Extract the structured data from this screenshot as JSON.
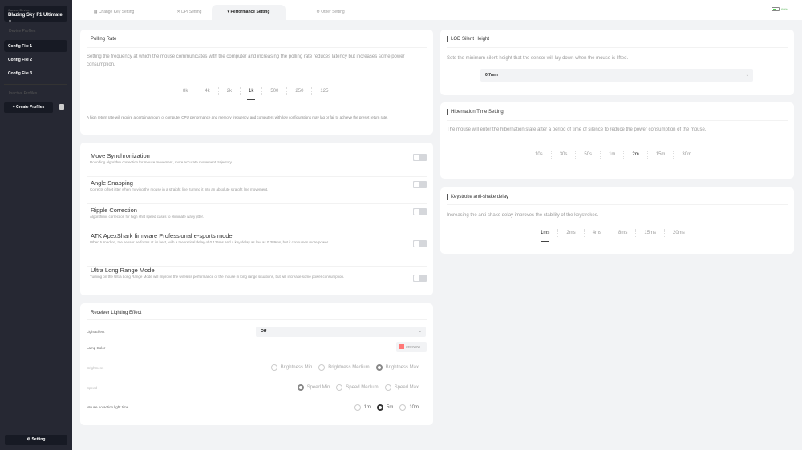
{
  "sidebar": {
    "device_label": "Current Device",
    "device_name": "Blazing Sky F1 Ultimate",
    "device_profiles": "Device Profiles",
    "configs": [
      "Config File 1",
      "Config File 2",
      "Config File 3"
    ],
    "active_config": 0,
    "inactive_profiles": "Inactive Profiles",
    "create": "Create Profiles",
    "setting": "Setting"
  },
  "tabs": [
    {
      "label": "Change Key Setting",
      "icon": "keyboard-icon"
    },
    {
      "label": "DPI Setting",
      "icon": "dpi-icon"
    },
    {
      "label": "Performance Setting",
      "icon": "performance-icon"
    },
    {
      "label": "Other Setting",
      "icon": "gear-icon"
    }
  ],
  "active_tab": 2,
  "battery": {
    "percent": "60%",
    "level": 60,
    "color": "#55cc55"
  },
  "polling": {
    "title": "Polling Rate",
    "desc": "Setting the frequency at which the mouse communicates with the computer and increasing the polling rate reduces latency but increases some power consumption.",
    "options": [
      "8k",
      "4k",
      "2k",
      "1k",
      "500",
      "250",
      "125"
    ],
    "selected": "1k",
    "note": "A high return rate will require a certain amount of computer CPU performance and memory frequency, and computers with low configurations may lag or fail to achieve the preset return rate."
  },
  "toggles": [
    {
      "title": "Move Synchronization",
      "desc": "Rounding algorithm correction for mouse movement, more accurate movement trajectory.",
      "on": false
    },
    {
      "title": "Angle Snapping",
      "desc": "Corrects offset jitter when moving the mouse in a straight line, turning it into an absolute straight line movement.",
      "on": false
    },
    {
      "title": "Ripple Correction",
      "desc": "Algorithmic correction for high shift speed cases to eliminate wavy jitter.",
      "on": false
    },
    {
      "title": "ATK ApexShark firmware Professional e-sports mode",
      "desc": "When turned on, the sensor performs at its best, with a theoretical delay of 0.125ms and a key delay as low as 0.389ms, but it consumes more power.",
      "on": false
    },
    {
      "title": "Ultra Long Range Mode",
      "desc": "Turning on the Ultra Long Range Mode will improve the wireless performance of the mouse in long range situations, but will increase some power consumption.",
      "on": false
    }
  ],
  "lighting": {
    "title": "Receiver Lighting Effect",
    "effect_label": "Light Effect",
    "effect_value": "Off",
    "color_label": "Lamp Color",
    "color_value": "#FF0000",
    "color_swatch": "#ff7777",
    "brightness_label": "Brightness",
    "brightness": [
      "Brightness Min",
      "Brightness Medium",
      "Brightness Max"
    ],
    "brightness_selected": 2,
    "speed_label": "Speed",
    "speed": [
      "Speed Min",
      "Speed Medium",
      "Speed Max"
    ],
    "speed_selected": 0,
    "noaction_label": "Mouse no action light time",
    "noaction": [
      "1m",
      "5m",
      "10m"
    ],
    "noaction_selected": 1
  },
  "lod": {
    "title": "LOD Silent Height",
    "desc": "Sets the minimum silent height that the sensor will lay down when the mouse is lifted.",
    "value": "0.7mm"
  },
  "hibernation": {
    "title": "Hibernation Time Setting",
    "desc": "The mouse will enter the hibernation state after a period of time of silence to reduce the power consumption of the mouse.",
    "options": [
      "10s",
      "30s",
      "50s",
      "1m",
      "2m",
      "15m",
      "30m"
    ],
    "selected": "2m"
  },
  "debounce": {
    "title": "Keystroke anti-shake delay",
    "desc": "Increasing the anti-shake delay improves the stability of the keystrokes.",
    "options": [
      "1ms",
      "2ms",
      "4ms",
      "8ms",
      "15ms",
      "20ms"
    ],
    "selected": "1ms"
  }
}
